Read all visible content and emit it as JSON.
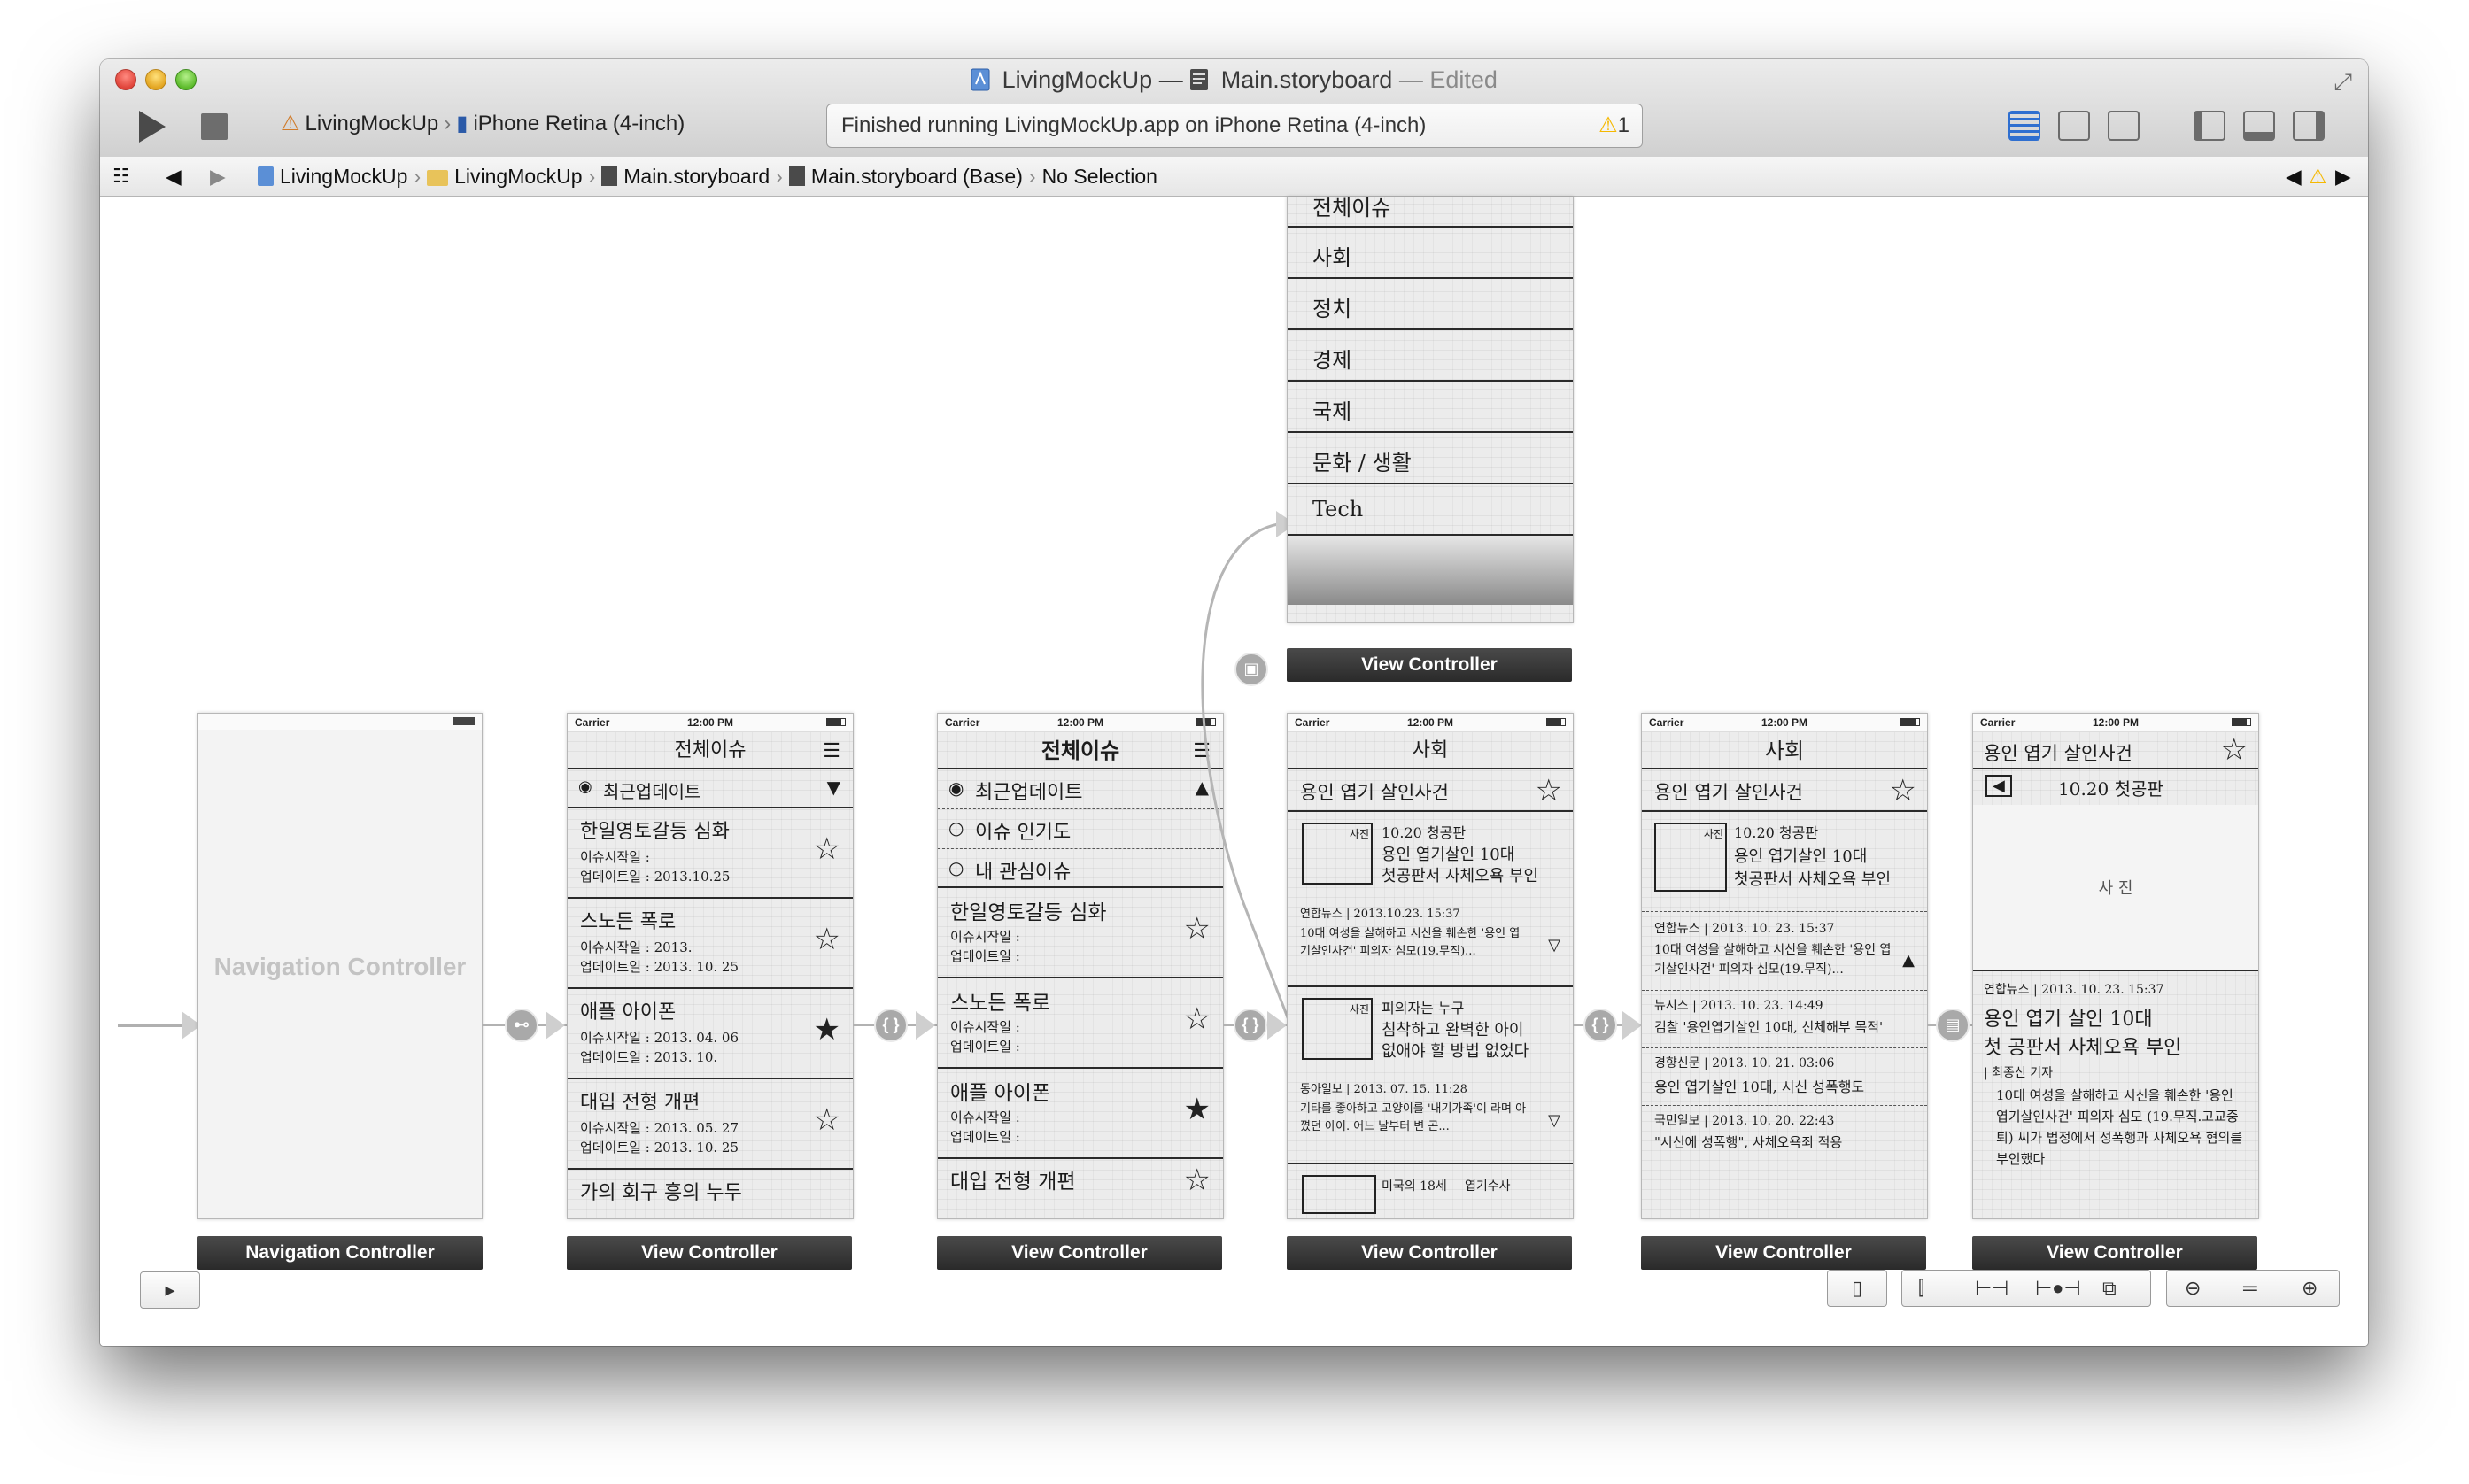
{
  "window": {
    "title_project": "LivingMockUp",
    "title_sep": "—",
    "title_file": "Main.storyboard",
    "title_state": "— Edited"
  },
  "toolbar": {
    "scheme_target": "LivingMockUp",
    "scheme_device": "iPhone Retina (4-inch)",
    "activity_text": "Finished running LivingMockUp.app on iPhone Retina (4-inch)",
    "warning_count": "1"
  },
  "jumpbar": {
    "crumbs": [
      "LivingMockUp",
      "LivingMockUp",
      "Main.storyboard",
      "Main.storyboard (Base)",
      "No Selection"
    ]
  },
  "scenes": {
    "nav": {
      "title": "Navigation Controller",
      "label": "Navigation Controller"
    },
    "vc1": {
      "label": "View Controller",
      "carrier": "Carrier",
      "time": "12:00 PM",
      "header": "전체이슈",
      "sub": "최근업데이트",
      "items": [
        {
          "title": "한일영토갈등 심화",
          "l1": "이슈시작일 :",
          "l2": "업데이트일 : 2013.10.25"
        },
        {
          "title": "스노든 폭로",
          "l1": "이슈시작일 : 2013.",
          "l2": "업데이트일 : 2013. 10. 25"
        },
        {
          "title": "애플 아이폰",
          "l1": "이슈시작일 : 2013. 04. 06",
          "l2": "업데이트일 : 2013. 10."
        },
        {
          "title": "대입 전형 개편",
          "l1": "이슈시작일 : 2013. 05. 27",
          "l2": "업데이트일 : 2013. 10. 25"
        },
        {
          "title": "가의 회구 흥의 누두",
          "l1": "",
          "l2": ""
        }
      ]
    },
    "vc2": {
      "label": "View Controller",
      "carrier": "Carrier",
      "time": "12:00 PM",
      "header": "전체이슈",
      "options": [
        "최근업데이트",
        "이슈 인기도",
        "내 관심이슈"
      ],
      "items": [
        {
          "title": "한일영토갈등 심화",
          "l1": "이슈시작일 :",
          "l2": "업데이트일 :"
        },
        {
          "title": "스노든 폭로",
          "l1": "이슈시작일 :",
          "l2": "업데이트일 :"
        },
        {
          "title": "애플 아이폰",
          "l1": "이슈시작일 :",
          "l2": "업데이트일 :"
        },
        {
          "title": "대입 전형 개편",
          "l1": "",
          "l2": ""
        }
      ]
    },
    "menu": {
      "label": "View Controller",
      "items": [
        "전체이슈",
        "사회",
        "정치",
        "경제",
        "국제",
        "문화 / 생활",
        "Tech"
      ]
    },
    "vc3": {
      "label": "View Controller",
      "carrier": "Carrier",
      "time": "12:00 PM",
      "header": "사회",
      "topic": "용인 엽기 살인사건",
      "blocks": [
        {
          "thumb": "사진",
          "t1": "10.20 청공판",
          "t2": "용인 엽기살인 10대",
          "t3": "첫공판서 사체오욕 부인",
          "meta": "연합뉴스 | 2013.10.23. 15:37",
          "body": "10대 여성을 살해하고 시신을 훼손한 '용인 엽기살인사건' 피의자 심모(19.무직)..."
        },
        {
          "thumb": "사진",
          "t1": "피의자는 누구",
          "t2": "침착하고 완벽한 아이",
          "t3": "없애야 할 방법 없었다",
          "meta": "동아일보 | 2013. 07. 15. 11:28",
          "body": "기타를 좋아하고 고양이를 '내기가족'이 라며 아꼈던 아이. 어느 날부터 변 곤..."
        },
        {
          "thumb": "",
          "t1": "미국의 18세",
          "t2": "엽기수사",
          "t3": "",
          "meta": "",
          "body": ""
        }
      ]
    },
    "vc4": {
      "label": "View Controller",
      "carrier": "Carrier",
      "time": "12:00 PM",
      "header": "사회",
      "topic": "용인 엽기 살인사건",
      "thumb": "사진",
      "t1": "10.20 청공판",
      "t2": "용인 엽기살인 10대",
      "t3": "첫공판서 사체오욕 부인",
      "news": [
        {
          "meta": "연합뉴스 | 2013. 10. 23. 15:37",
          "body": "10대 여성을 살해하고 시신을 훼손한 '용인 엽기살인사건' 피의자 심모(19.무직)..."
        },
        {
          "meta": "뉴시스 | 2013. 10. 23. 14:49",
          "body": "검찰 '용인엽기살인 10대, 신체해부 목적'"
        },
        {
          "meta": "경향신문 | 2013. 10. 21. 03:06",
          "body": "용인 엽기살인 10대, 시신 성폭행도"
        },
        {
          "meta": "국민일보 | 2013. 10. 20. 22:43",
          "body": "\"시신에 성폭행\", 사체오욕죄 적용"
        }
      ]
    },
    "vc5": {
      "label": "View Controller",
      "carrier": "Carrier",
      "time": "12:00 PM",
      "header": "용인 엽기 살인사건",
      "date_line": "10.20 첫공판",
      "photo": "사 진",
      "meta": "연합뉴스 | 2013. 10. 23. 15:37",
      "headline1": "용인 엽기 살인 10대",
      "headline2": "첫 공판서 사체오욕 부인",
      "byline": "| 최종신 기자",
      "body": "10대 여성을 살해하고 시신을 훼손한 '용인 엽기살인사건' 피의자 심모 (19.무직.고교중퇴) 씨가 법정에서 성폭행과 사체오욕 혐의를 부인했다"
    }
  },
  "icons": {
    "warning": "warning-icon",
    "storyboard": "storyboard-file-icon",
    "folder": "folder-icon",
    "project": "project-icon"
  },
  "colors": {
    "label_bg": "#333333",
    "warning": "#f5b800",
    "segue": "#a9a9a9"
  }
}
